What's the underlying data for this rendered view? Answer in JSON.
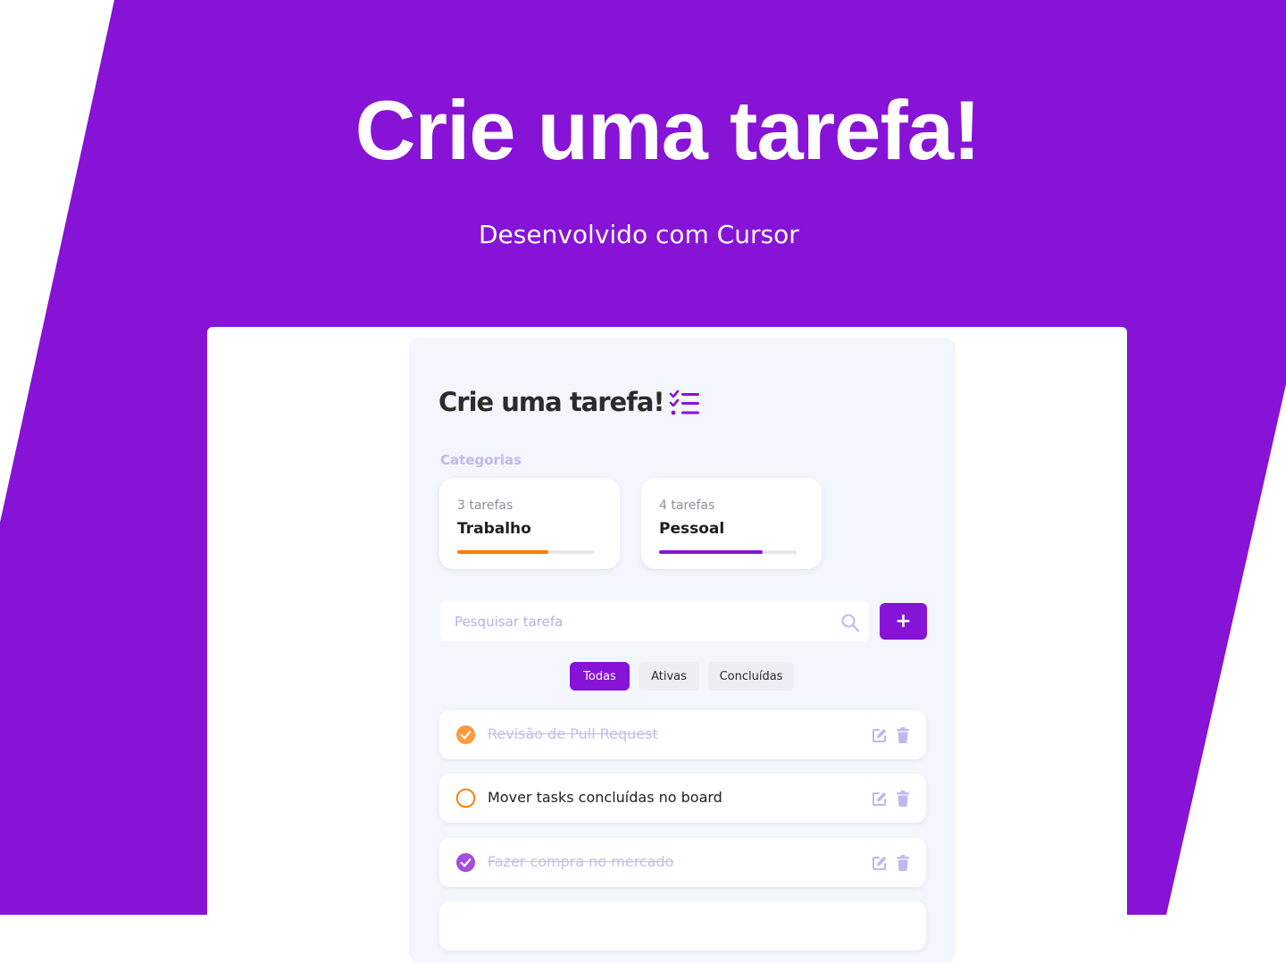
{
  "hero": {
    "title": "Crie uma tarefa!",
    "subtitle": "Desenvolvido com Cursor"
  },
  "app": {
    "title": "Crie uma tarefa!",
    "title_icon": "checklist-icon",
    "categories_label": "Categorias",
    "categories": [
      {
        "count": "3 tarefas",
        "name": "Trabalho",
        "progress": 0.66,
        "color": "#ff7a00"
      },
      {
        "count": "4 tarefas",
        "name": "Pessoal",
        "progress": 0.75,
        "color": "#8613d6"
      }
    ],
    "search": {
      "placeholder": "Pesquisar tarefa",
      "icon": "search-icon"
    },
    "add_button": "+",
    "filters": [
      {
        "label": "Todas",
        "active": true
      },
      {
        "label": "Ativas",
        "active": false
      },
      {
        "label": "Concluídas",
        "active": false
      }
    ],
    "tasks": [
      {
        "text": "Revisão de Pull Request",
        "done": true,
        "color": "#ff9a3c"
      },
      {
        "text": "Mover tasks concluídas no board",
        "done": false,
        "color": "#ff7a00"
      },
      {
        "text": "Fazer compra no mercado",
        "done": true,
        "color": "#a64be0"
      }
    ]
  },
  "colors": {
    "brand": "#8613d6",
    "work": "#ff7a00",
    "icon_muted": "#c1b6f0"
  }
}
